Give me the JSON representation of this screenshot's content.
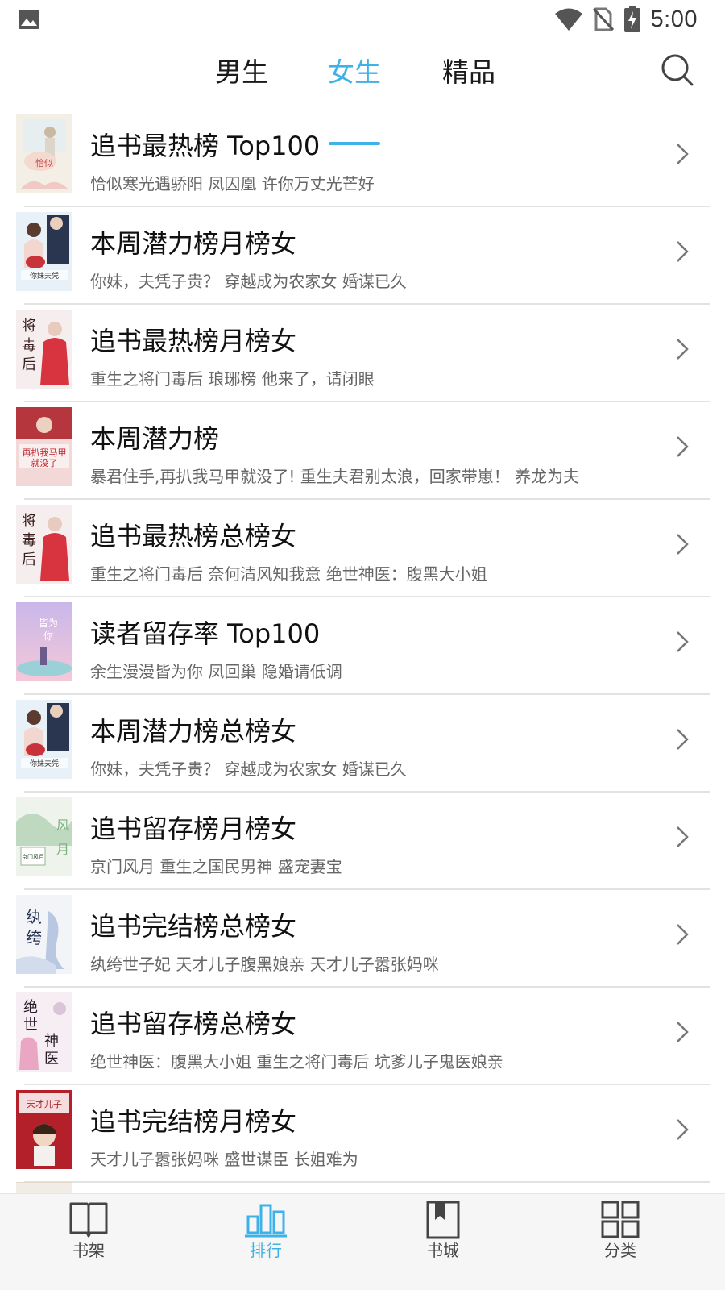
{
  "status_bar": {
    "time": "5:00"
  },
  "top_tabs": {
    "items": [
      {
        "label": "男生",
        "active": false
      },
      {
        "label": "女生",
        "active": true
      },
      {
        "label": "精品",
        "active": false
      }
    ],
    "accent_color": "#3db2e8"
  },
  "rank_list": [
    {
      "title": "追书最热榜 Top100",
      "books": "恰似寒光遇骄阳  凤囚凰  许你万丈光芒好",
      "cover": "cover-warm-pastel"
    },
    {
      "title": "本周潜力榜月榜女",
      "books": "你妹，夫凭子贵？  穿越成为农家女  婚谋已久",
      "cover": "cover-couple-blue"
    },
    {
      "title": "追书最热榜月榜女",
      "books": "重生之将门毒后  琅琊榜  他来了，请闭眼",
      "cover": "cover-red-robe"
    },
    {
      "title": "本周潜力榜",
      "books": "暴君住手,再扒我马甲就没了! 重生夫君别太浪，回家带崽！  养龙为夫",
      "cover": "cover-red-title"
    },
    {
      "title": "追书最热榜总榜女",
      "books": "重生之将门毒后  奈何清风知我意  绝世神医：腹黑大小姐",
      "cover": "cover-red-robe"
    },
    {
      "title": "读者留存率 Top100",
      "books": "余生漫漫皆为你  凤回巢  隐婚请低调",
      "cover": "cover-purple-sky"
    },
    {
      "title": "本周潜力榜总榜女",
      "books": "你妹，夫凭子贵？  穿越成为农家女  婚谋已久",
      "cover": "cover-couple-blue"
    },
    {
      "title": "追书留存榜月榜女",
      "books": "京门风月  重生之国民男神  盛宠妻宝",
      "cover": "cover-green-ink"
    },
    {
      "title": "追书完结榜总榜女",
      "books": "纨绔世子妃  天才儿子腹黑娘亲  天才儿子嚣张妈咪",
      "cover": "cover-blue-ink"
    },
    {
      "title": "追书留存榜总榜女",
      "books": "绝世神医：腹黑大小姐  重生之将门毒后  坑爹儿子鬼医娘亲",
      "cover": "cover-calligraphy"
    },
    {
      "title": "追书完结榜月榜女",
      "books": "天才儿子嚣张妈咪  盛世谋臣  长姐难为",
      "cover": "cover-red-chibi"
    }
  ],
  "bottom_nav": [
    {
      "label": "书架",
      "icon": "book-open-icon",
      "active": false
    },
    {
      "label": "排行",
      "icon": "bar-chart-icon",
      "active": true
    },
    {
      "label": "书城",
      "icon": "bookmark-book-icon",
      "active": false
    },
    {
      "label": "分类",
      "icon": "grid-icon",
      "active": false
    }
  ]
}
